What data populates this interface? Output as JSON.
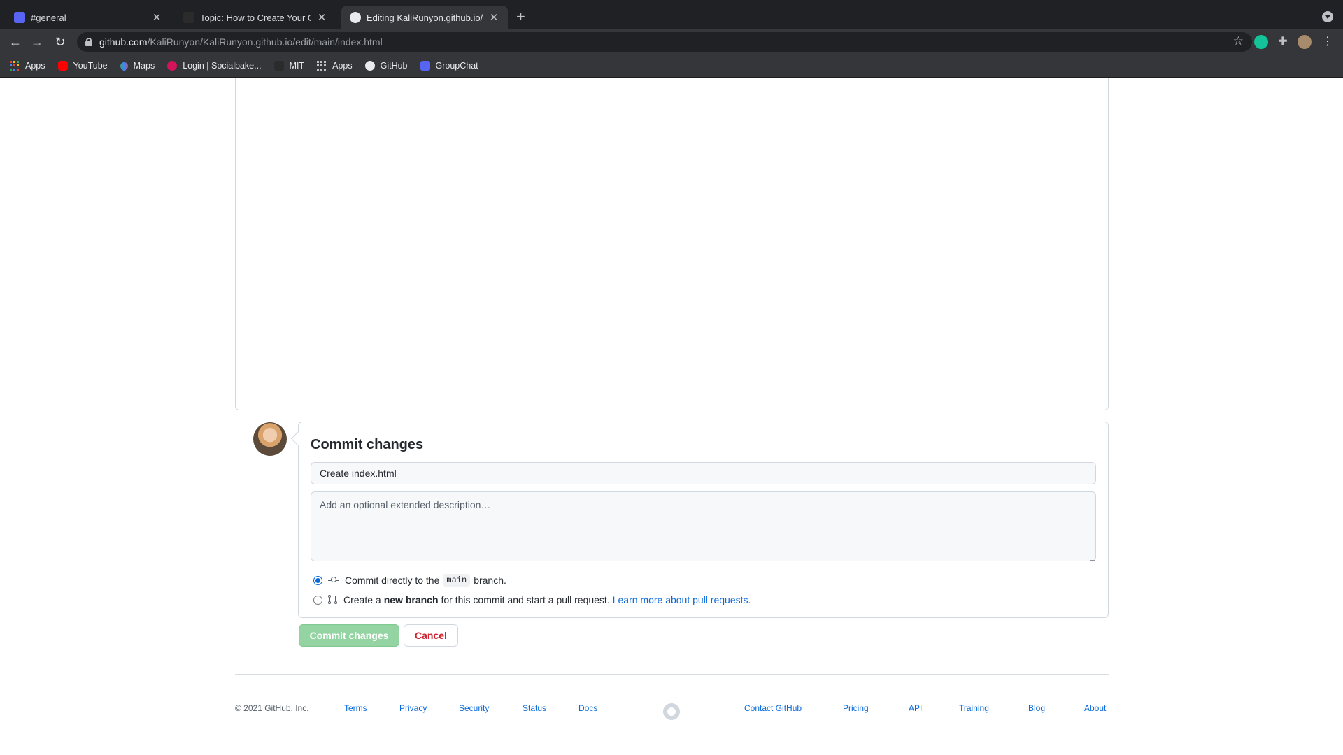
{
  "browser": {
    "tabs": [
      {
        "title": "#general",
        "icon": "discord-icon"
      },
      {
        "title": "Topic: How to Create Your Own",
        "icon": "codecademy-icon"
      },
      {
        "title": "Editing KaliRunyon.github.io/in",
        "icon": "github-icon"
      }
    ],
    "url_host": "github.com",
    "url_path": "/KaliRunyon/KaliRunyon.github.io/edit/main/index.html",
    "bookmarks": [
      {
        "label": "Apps",
        "icon": "apps-grid-icon"
      },
      {
        "label": "YouTube",
        "icon": "youtube-icon"
      },
      {
        "label": "Maps",
        "icon": "maps-icon"
      },
      {
        "label": "Login | Socialbake...",
        "icon": "socialbakers-icon"
      },
      {
        "label": "MIT",
        "icon": "codecademy-icon"
      },
      {
        "label": "Apps",
        "icon": "apps-grid-icon"
      },
      {
        "label": "GitHub",
        "icon": "github-icon"
      },
      {
        "label": "GroupChat",
        "icon": "discord-icon"
      }
    ],
    "colors": {
      "chrome_dark": "#202124",
      "chrome_toolbar": "#35363a"
    }
  },
  "commit": {
    "title": "Commit changes",
    "summary_value": "Create index.html",
    "description_placeholder": "Add an optional extended description…",
    "option_direct": {
      "prefix": "Commit directly to the",
      "branch": "main",
      "suffix": "branch."
    },
    "option_new_branch": {
      "prefix": "Create a",
      "bold": "new branch",
      "suffix": "for this commit and start a pull request.",
      "link": "Learn more about pull requests."
    },
    "commit_button": "Commit changes",
    "cancel_button": "Cancel",
    "colors": {
      "commit_button": "#94d3a2",
      "cancel_text": "#cf222e",
      "link": "#0969da"
    }
  },
  "footer": {
    "copyright": "© 2021 GitHub, Inc.",
    "left_links": [
      "Terms",
      "Privacy",
      "Security",
      "Status",
      "Docs"
    ],
    "right_links": [
      "Contact GitHub",
      "Pricing",
      "API",
      "Training",
      "Blog",
      "About"
    ]
  }
}
